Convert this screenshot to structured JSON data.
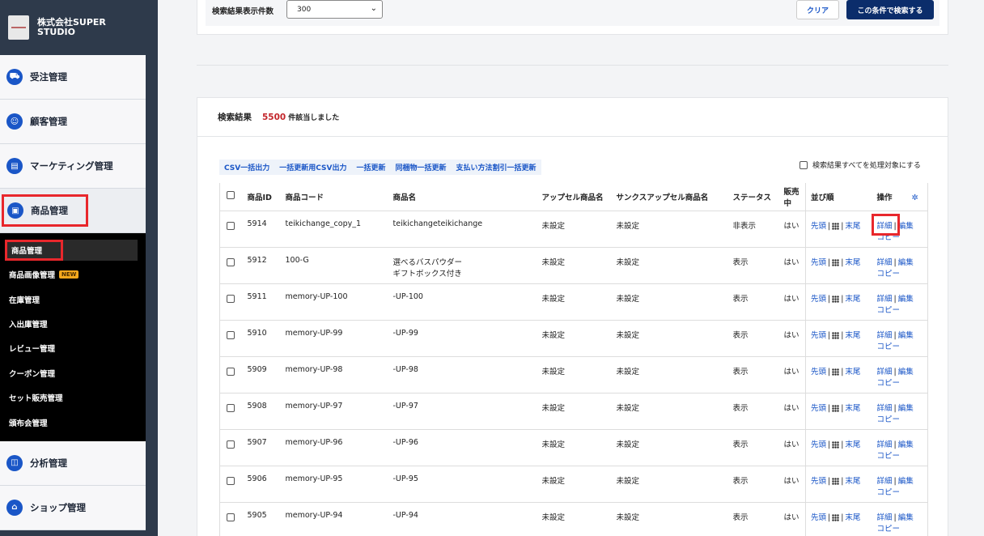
{
  "brand": {
    "name": "株式会社SUPER STUDIO"
  },
  "nav": {
    "items": [
      {
        "label": "受注管理",
        "icon": "cart-icon"
      },
      {
        "label": "顧客管理",
        "icon": "user-icon"
      },
      {
        "label": "マーケティング管理",
        "icon": "chart-icon"
      },
      {
        "label": "商品管理",
        "icon": "box-icon",
        "active": true
      },
      {
        "label": "分析管理",
        "icon": "analytics-icon"
      },
      {
        "label": "ショップ管理",
        "icon": "shop-icon"
      }
    ],
    "sub_items": [
      {
        "label": "商品管理",
        "current": true
      },
      {
        "label": "商品画像管理",
        "badge": "NEW"
      },
      {
        "label": "在庫管理"
      },
      {
        "label": "入出庫管理"
      },
      {
        "label": "レビュー管理"
      },
      {
        "label": "クーポン管理"
      },
      {
        "label": "セット販売管理"
      },
      {
        "label": "頒布会管理"
      }
    ]
  },
  "search": {
    "count_label": "検索結果表示件数",
    "count_value": "300",
    "clear_label": "クリア",
    "search_label": "この条件で検索する"
  },
  "results": {
    "title": "検索結果",
    "count": "5500",
    "suffix": "件該当しました",
    "bulk_actions": [
      "CSV一括出力",
      "一括更新用CSV出力",
      "一括更新",
      "同梱物一括更新",
      "支払い方法割引一括更新"
    ],
    "all_target_label": "検索結果すべてを処理対象にする",
    "columns": [
      "商品ID",
      "商品コード",
      "商品名",
      "アップセル商品名",
      "サンクスアップセル商品名",
      "ステータス",
      "販売中",
      "並び順",
      "操作"
    ],
    "sort_links": {
      "first": "先頭",
      "last": "末尾"
    },
    "op_links": {
      "detail": "詳細",
      "edit": "編集",
      "copy": "コピー"
    },
    "rows": [
      {
        "id": "5914",
        "code": "teikichange_copy_1",
        "name": "teikichangeteikichange",
        "name2": "",
        "upsell": "未設定",
        "thanks": "未設定",
        "status": "非表示",
        "on_sale": "はい"
      },
      {
        "id": "5912",
        "code": "100-G",
        "name": "選べるバスパウダー",
        "name2": "ギフトボックス付き",
        "upsell": "未設定",
        "thanks": "未設定",
        "status": "表示",
        "on_sale": "はい"
      },
      {
        "id": "5911",
        "code": "memory-UP-100",
        "name": "-UP-100",
        "name2": "",
        "upsell": "未設定",
        "thanks": "未設定",
        "status": "表示",
        "on_sale": "はい"
      },
      {
        "id": "5910",
        "code": "memory-UP-99",
        "name": "-UP-99",
        "name2": "",
        "upsell": "未設定",
        "thanks": "未設定",
        "status": "表示",
        "on_sale": "はい"
      },
      {
        "id": "5909",
        "code": "memory-UP-98",
        "name": "-UP-98",
        "name2": "",
        "upsell": "未設定",
        "thanks": "未設定",
        "status": "表示",
        "on_sale": "はい"
      },
      {
        "id": "5908",
        "code": "memory-UP-97",
        "name": "-UP-97",
        "name2": "",
        "upsell": "未設定",
        "thanks": "未設定",
        "status": "表示",
        "on_sale": "はい"
      },
      {
        "id": "5907",
        "code": "memory-UP-96",
        "name": "-UP-96",
        "name2": "",
        "upsell": "未設定",
        "thanks": "未設定",
        "status": "表示",
        "on_sale": "はい"
      },
      {
        "id": "5906",
        "code": "memory-UP-95",
        "name": "-UP-95",
        "name2": "",
        "upsell": "未設定",
        "thanks": "未設定",
        "status": "表示",
        "on_sale": "はい"
      },
      {
        "id": "5905",
        "code": "memory-UP-94",
        "name": "-UP-94",
        "name2": "",
        "upsell": "未設定",
        "thanks": "未設定",
        "status": "表示",
        "on_sale": "はい"
      }
    ]
  },
  "colors": {
    "accent": "#1a56c7",
    "highlight": "#e8272c",
    "count": "#c3262b",
    "primary_button": "#0b2d6b"
  }
}
